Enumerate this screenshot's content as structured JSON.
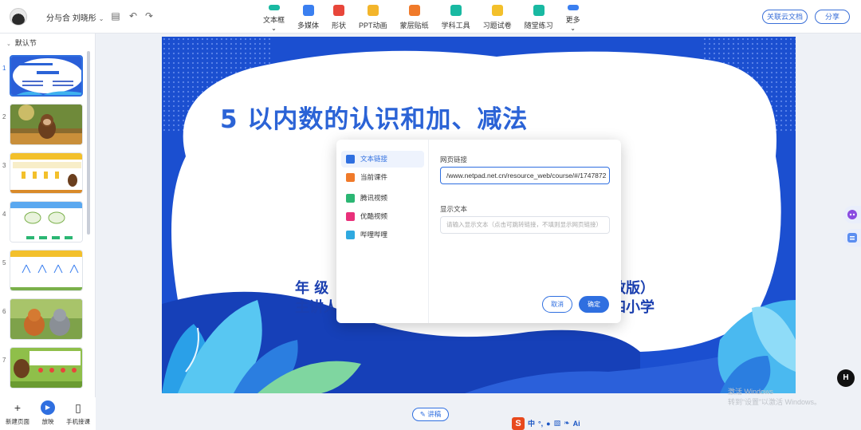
{
  "header": {
    "doc_title": "分与合 刘晓彤",
    "tools": [
      {
        "label": "文本框",
        "icon": "textbox-icon",
        "color": "#19b9a2",
        "has_menu": true
      },
      {
        "label": "多媒体",
        "icon": "media-icon",
        "color": "#3a7ff0"
      },
      {
        "label": "形状",
        "icon": "shape-icon",
        "color": "#e8463a"
      },
      {
        "label": "PPT动画",
        "icon": "animation-icon",
        "color": "#f3b52b"
      },
      {
        "label": "蒙层贴纸",
        "icon": "sticker-icon",
        "color": "#f07a2a"
      },
      {
        "label": "学科工具",
        "icon": "subject-tool-icon",
        "color": "#19b9a2"
      },
      {
        "label": "习题试卷",
        "icon": "exercise-icon",
        "color": "#f3c02b"
      },
      {
        "label": "随堂练习",
        "icon": "practice-icon",
        "color": "#19b9a2"
      },
      {
        "label": "更多",
        "icon": "more-icon",
        "color": "#3a7ff0",
        "has_menu": true
      }
    ],
    "cloud_button": "关联云文档",
    "share_button": "分享"
  },
  "sidebar": {
    "section_title": "默认节",
    "slides": [
      "1",
      "2",
      "3",
      "4",
      "5",
      "6",
      "7"
    ],
    "bottom": {
      "new_page": "新建页面",
      "play": "放映",
      "mobile": "手机接课"
    }
  },
  "slide": {
    "title": "5 以内数的认识和加、减法",
    "line1_left": "年   级",
    "line1_right": "人教版）",
    "line2_left": "主讲人",
    "line2_right": "第四小学"
  },
  "dialog": {
    "menu": [
      {
        "label": "文本链接",
        "icon": "link-icon",
        "color": "#2f6fe0"
      },
      {
        "label": "当前课件",
        "icon": "courseware-icon",
        "color": "#f07a2a"
      },
      {
        "label": "腾讯视频",
        "icon": "tencent-video-icon",
        "color": "#2bb673"
      },
      {
        "label": "优酷视频",
        "icon": "youku-icon",
        "color": "#e9307a"
      },
      {
        "label": "哔哩哔哩",
        "icon": "bilibili-icon",
        "color": "#2fa9e0"
      }
    ],
    "url_label": "网页链接",
    "url_value": "/www.netpad.net.cn/resource_web/course/#/1747872",
    "text_label": "显示文本",
    "text_placeholder": "请输入显示文本（点击可跳转链接，不填则显示网页链接）",
    "cancel": "取消",
    "ok": "确定"
  },
  "footer": {
    "notes": "讲稿",
    "watermark_line1": "激活 Windows",
    "watermark_line2": "转到“设置”以激活 Windows。",
    "ime_lang": "中"
  }
}
